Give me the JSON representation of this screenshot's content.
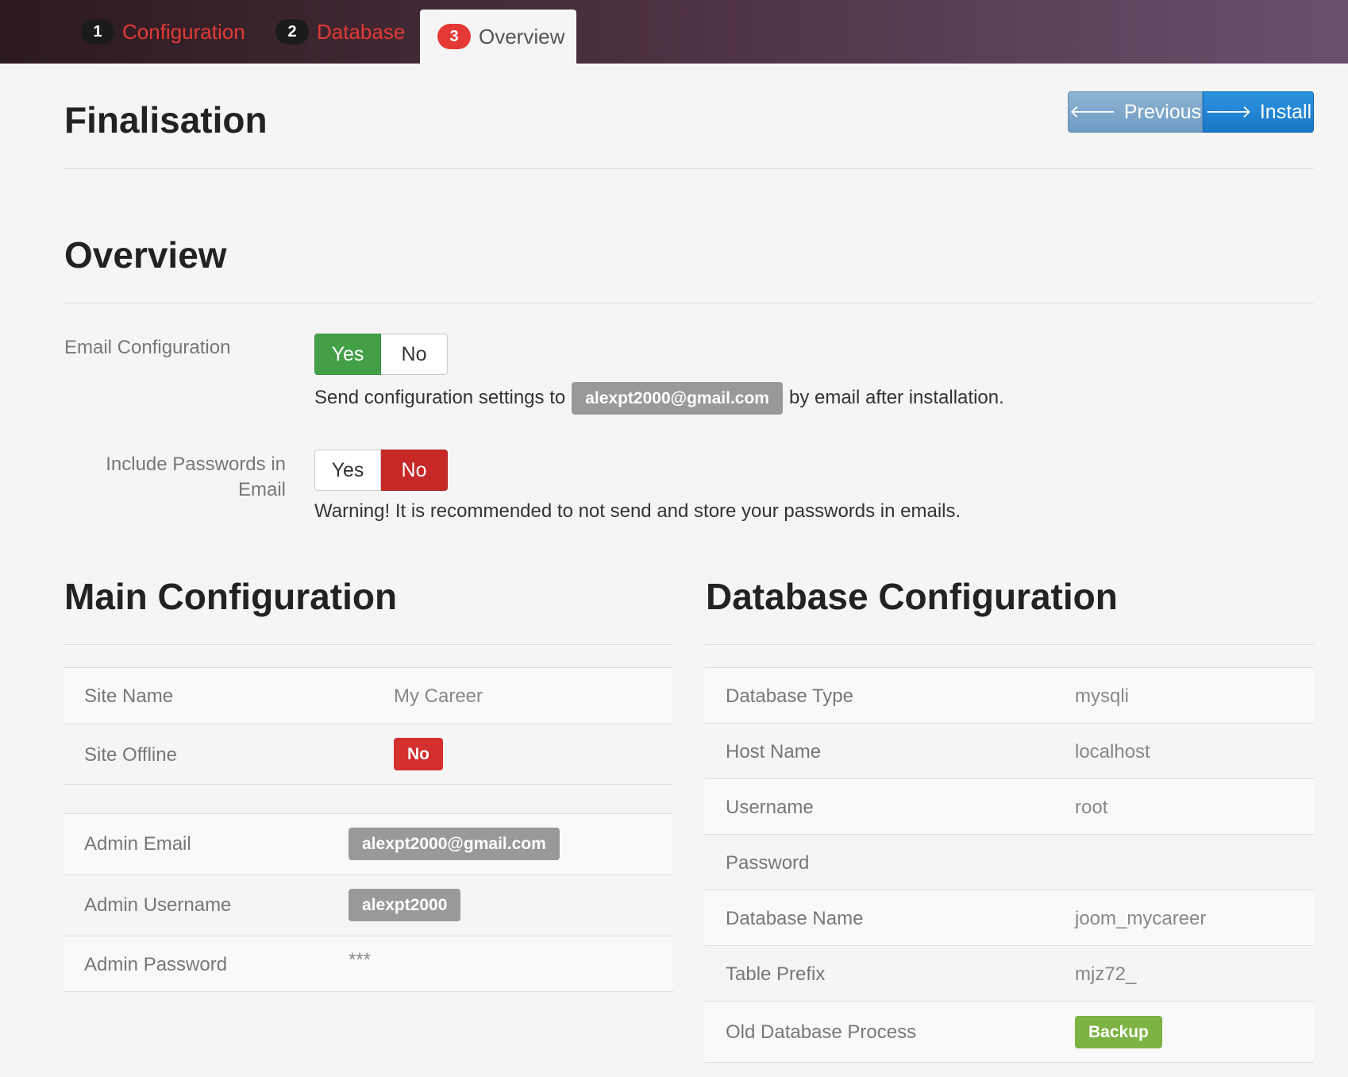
{
  "tabs": [
    {
      "num": "1",
      "label": "Configuration"
    },
    {
      "num": "2",
      "label": "Database"
    },
    {
      "num": "3",
      "label": "Overview"
    }
  ],
  "page_title": "Finalisation",
  "buttons": {
    "previous": "Previous",
    "install": "Install"
  },
  "overview": {
    "title": "Overview",
    "email_config": {
      "label": "Email Configuration",
      "yes": "Yes",
      "no": "No",
      "note_before": "Send configuration settings to",
      "email": "alexpt2000@gmail.com",
      "note_after": "by email after installation."
    },
    "include_passwords": {
      "label_line1": "Include Passwords in",
      "label_line2": "Email",
      "yes": "Yes",
      "no": "No",
      "warning": "Warning! It is recommended to not send and store your passwords in emails."
    }
  },
  "main_config": {
    "title": "Main Configuration",
    "site_name": {
      "label": "Site Name",
      "value": "My Career"
    },
    "site_offline": {
      "label": "Site Offline",
      "value": "No"
    },
    "admin_email": {
      "label": "Admin Email",
      "value": "alexpt2000@gmail.com"
    },
    "admin_username": {
      "label": "Admin Username",
      "value": "alexpt2000"
    },
    "admin_password": {
      "label": "Admin Password",
      "value": "***"
    }
  },
  "db_config": {
    "title": "Database Configuration",
    "rows": [
      {
        "label": "Database Type",
        "value": "mysqli"
      },
      {
        "label": "Host Name",
        "value": "localhost"
      },
      {
        "label": "Username",
        "value": "root"
      },
      {
        "label": "Password",
        "value": ""
      },
      {
        "label": "Database Name",
        "value": "joom_mycareer"
      },
      {
        "label": "Table Prefix",
        "value": "mjz72_"
      },
      {
        "label": "Old Database Process",
        "value": "Backup"
      }
    ]
  }
}
